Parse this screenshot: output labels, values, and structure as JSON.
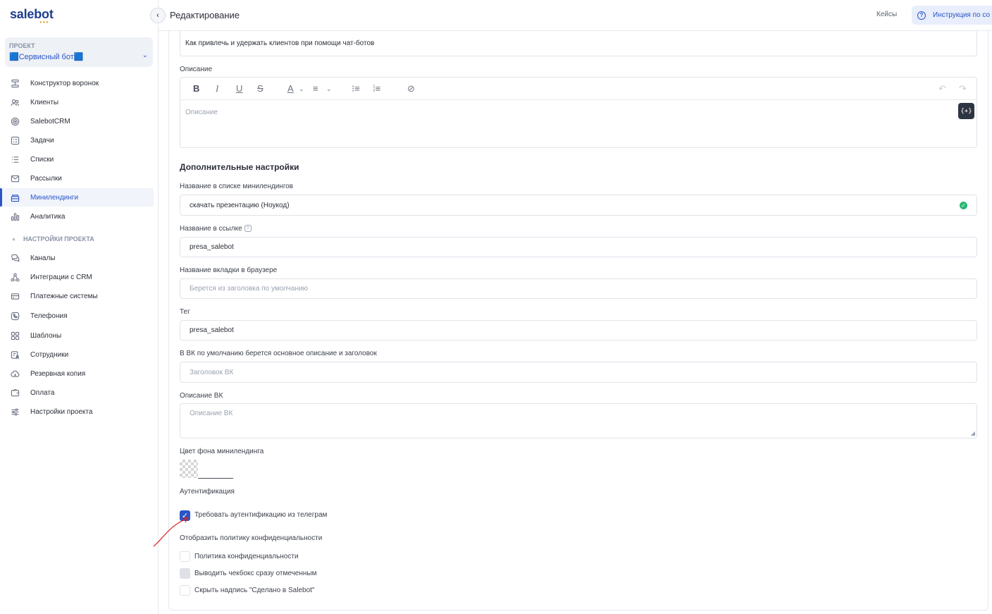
{
  "app": {
    "logo": "salebot",
    "logo_dots": "●●●"
  },
  "project": {
    "caption": "ПРОЕКТ",
    "name": "🟦Сервисный бот🟦"
  },
  "sidebar": {
    "items": [
      {
        "label": "Конструктор воронок",
        "icon": "funnel-icon"
      },
      {
        "label": "Клиенты",
        "icon": "users-icon"
      },
      {
        "label": "SalebotCRM",
        "icon": "target-icon"
      },
      {
        "label": "Задачи",
        "icon": "tasks-icon"
      },
      {
        "label": "Списки",
        "icon": "list-icon"
      },
      {
        "label": "Рассылки",
        "icon": "mail-icon"
      },
      {
        "label": "Минилендинги",
        "icon": "landing-icon"
      },
      {
        "label": "Аналитика",
        "icon": "analytics-icon"
      }
    ],
    "section_title": "НАСТРОЙКИ ПРОЕКТА",
    "settings_items": [
      {
        "label": "Каналы",
        "icon": "chat-icon"
      },
      {
        "label": "Интеграции с CRM",
        "icon": "integrations-icon"
      },
      {
        "label": "Платежные системы",
        "icon": "card-icon"
      },
      {
        "label": "Телефония",
        "icon": "phone-icon"
      },
      {
        "label": "Шаблоны",
        "icon": "templates-icon"
      },
      {
        "label": "Сотрудники",
        "icon": "staff-icon"
      },
      {
        "label": "Резервная копия",
        "icon": "cloud-icon"
      },
      {
        "label": "Оплата",
        "icon": "wallet-icon"
      },
      {
        "label": "Настройки проекта",
        "icon": "sliders-icon"
      }
    ]
  },
  "header": {
    "title": "Редактирование",
    "cases": "Кейсы",
    "help": "Инструкция по со"
  },
  "form": {
    "title_value": "Как привлечь и удержать клиентов при помощи чат-ботов",
    "description_label": "Описание",
    "description_placeholder": "Описание",
    "var_button": "{+}",
    "extra_title": "Дополнительные настройки",
    "list_name_label": "Название в списке минилендингов",
    "list_name_value": "скачать презентацию (Ноукод)",
    "link_name_label": "Название в ссылке",
    "link_name_value": "presa_salebot",
    "tab_name_label": "Название вкладки в браузере",
    "tab_name_placeholder": "Берется из заголовка по умолчанию",
    "tag_label": "Тег",
    "tag_value": "presa_salebot",
    "vk_label": "В ВК по умолчанию берется основное описание и заголовок",
    "vk_title_placeholder": "Заголовок ВК",
    "vk_desc_label": "Описание ВК",
    "vk_desc_placeholder": "Описание ВК",
    "bg_color_label": "Цвет фона минилендинга",
    "auth_label": "Аутентификация",
    "auth_checkbox": "Требовать аутентификацию из телеграм",
    "auth_checked": true,
    "policy_label": "Отобразить политику конфиденциальности",
    "policy_checkbox": "Политика конфиденциальности",
    "policy_checked_checkbox": "Выводить чекбокс сразу отмеченным",
    "hide_made_checkbox": "Скрыть надпись \"Сделано в Salebot\""
  },
  "colors": {
    "accent": "#2a55c9",
    "success": "#2bb673",
    "annotation": "#e0231f"
  }
}
